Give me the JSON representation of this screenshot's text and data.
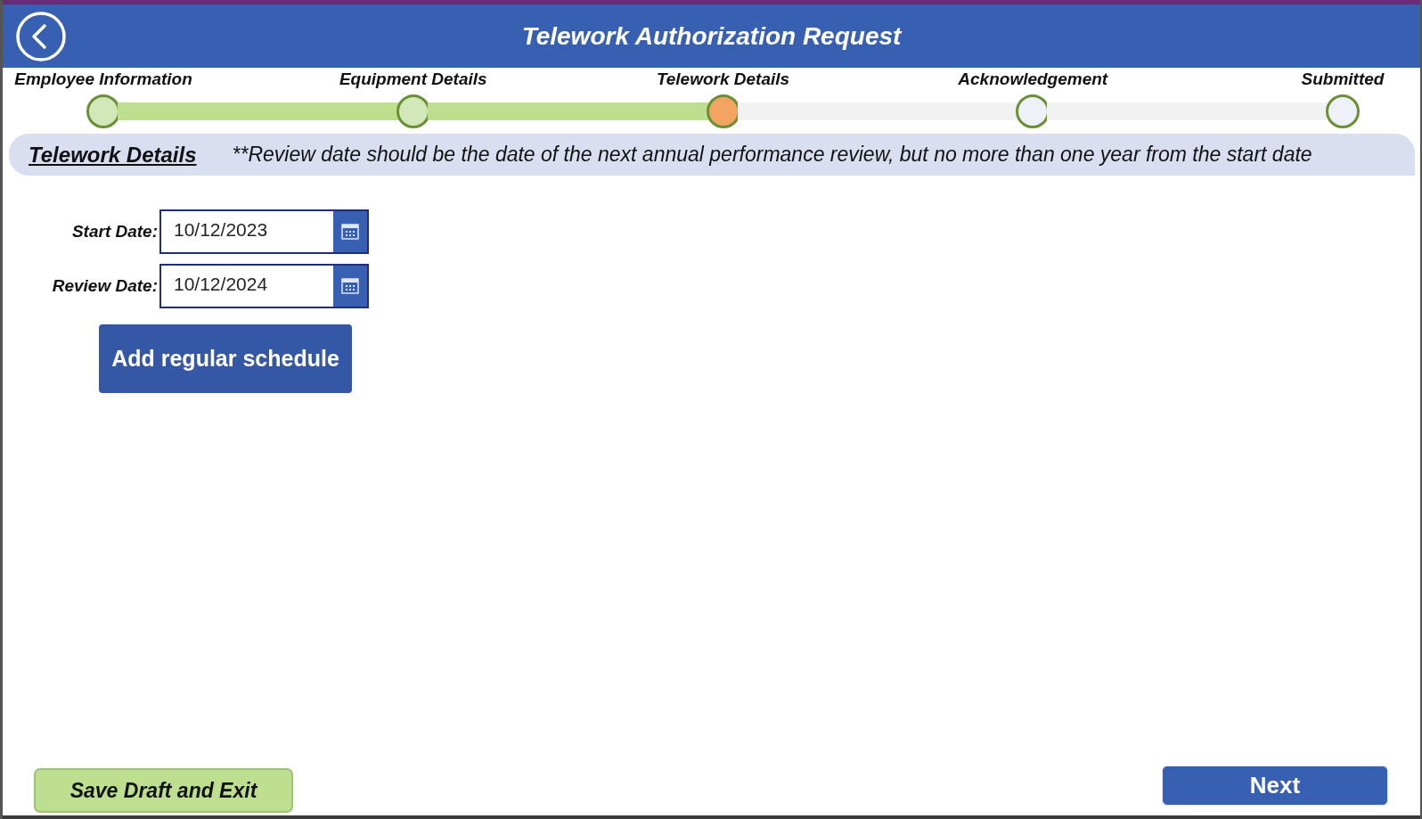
{
  "header": {
    "title": "Telework Authorization Request"
  },
  "steps": [
    {
      "label": "Employee Information",
      "done": true,
      "selected": false
    },
    {
      "label": "Equipment Details",
      "done": true,
      "selected": false
    },
    {
      "label": "Telework Details",
      "done": false,
      "selected": true
    },
    {
      "label": "Acknowledgement",
      "done": false,
      "selected": false
    },
    {
      "label": "Submitted",
      "done": false,
      "selected": false
    }
  ],
  "section": {
    "title": "Telework Details",
    "note": "**Review date should be the date of the next annual performance review, but no more than one year from the start date"
  },
  "fields": [
    {
      "label": "Start Date:",
      "value": "10/12/2023"
    },
    {
      "label": "Review Date:",
      "value": "10/12/2024"
    }
  ],
  "schedule_button": "Add regular schedule",
  "footer": {
    "save_button": "Save Draft and Exit",
    "next_button": "Next"
  }
}
